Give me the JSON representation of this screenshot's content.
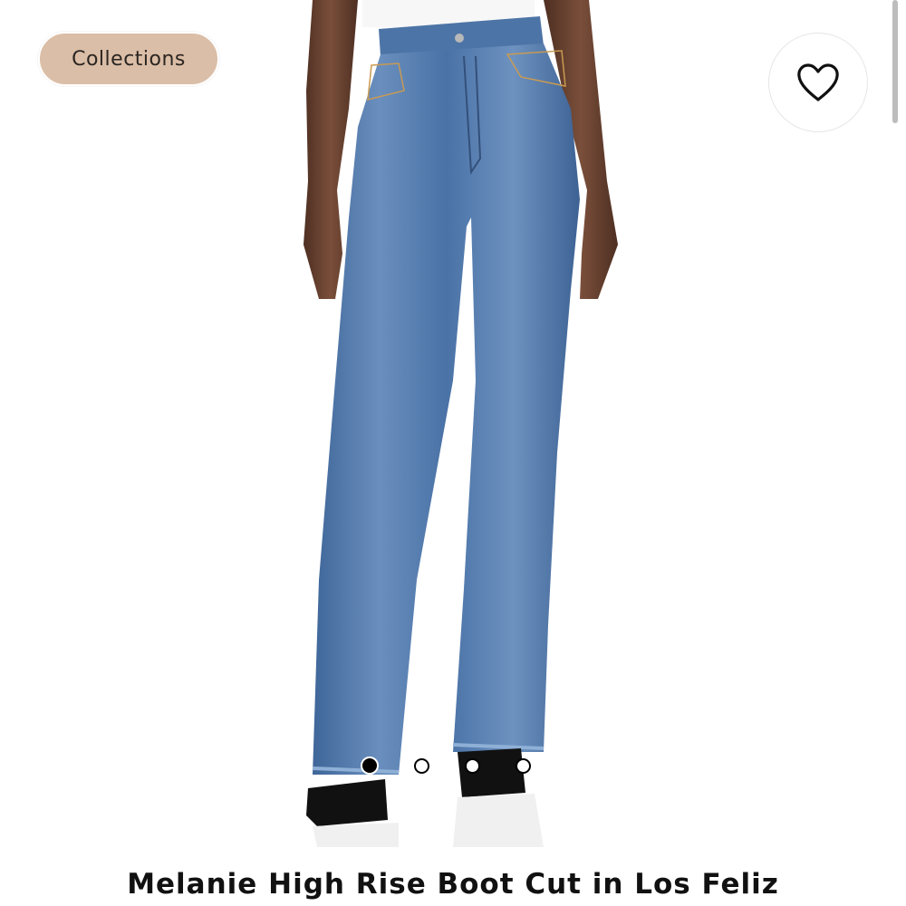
{
  "header": {
    "collections_label": "Collections"
  },
  "colors": {
    "collections_pill_bg": "#dbbea7",
    "denim": "#5b7fae",
    "skin": "#6b4532"
  },
  "carousel": {
    "total_images": 4,
    "active_index": 0
  },
  "product": {
    "title": "Melanie High Rise Boot Cut in Los Feliz",
    "favorited": false
  }
}
